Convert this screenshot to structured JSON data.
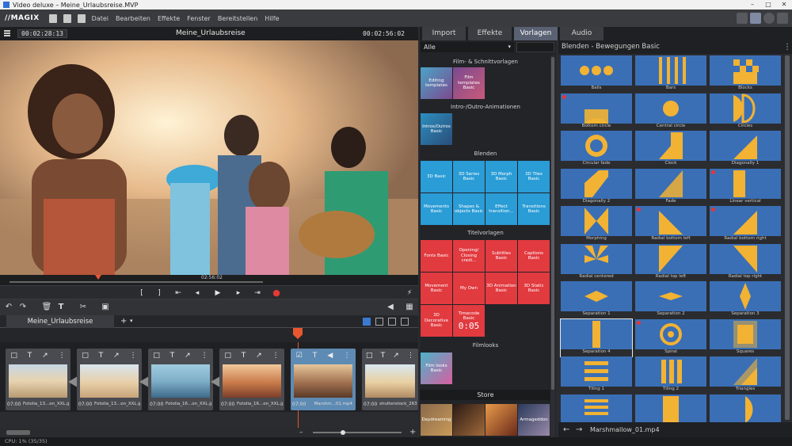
{
  "window": {
    "title": "Video deluxe – Meine_Urlaubsreise.MVP"
  },
  "menubar": {
    "logo": "//MAGIX",
    "items": [
      "Datei",
      "Bearbeiten",
      "Effekte",
      "Fenster",
      "Bereitstellen",
      "Hilfe"
    ]
  },
  "preview": {
    "timecode_left": "00:02:28:13",
    "title": "Meine_Urlaubsreise",
    "timecode_right": "00:02:56:02",
    "scrub_label": "02:56:02",
    "playhead_fraction": 0.24
  },
  "timeline": {
    "tab_label": "Meine_Urlaubsreise",
    "clips": [
      {
        "duration": "07:00",
        "name": "Fotolia_13...on_XXL.jpg",
        "selected": false
      },
      {
        "duration": "07:00",
        "name": "Fotolia_13...on_XXL.jpg",
        "selected": false
      },
      {
        "duration": "07:00",
        "name": "Fotolia_16...on_XXL.jpg",
        "selected": false
      },
      {
        "duration": "07:00",
        "name": "Fotolia_16...on_XXL.jpg",
        "selected": false
      },
      {
        "duration": "07:00",
        "name": "Marshm...01.mp4",
        "selected": true
      },
      {
        "duration": "07:00",
        "name": "shutterstock_26363...",
        "selected": false
      }
    ]
  },
  "status": {
    "cpu": "CPU: 1% (35/35)"
  },
  "right_tabs": [
    "Import",
    "Effekte",
    "Vorlagen",
    "Audio"
  ],
  "right_active_tab": "Vorlagen",
  "templates": {
    "filter": "Alle",
    "sections": {
      "film": {
        "title": "Film- & Schnittvorlagen",
        "items": [
          "Editing templates",
          "Film templates Basic"
        ]
      },
      "intro": {
        "title": "Intro-/Outro-Animationen",
        "items": [
          "Intros/Outros Basic"
        ]
      },
      "blenden": {
        "title": "Blenden",
        "items": [
          "3D Basic",
          "3D Series Basic",
          "3D Morph Basic",
          "3D Tiles Basic",
          "Movements Basic",
          "Shapes & objects Basic",
          "Effect transition...",
          "Transitions Basic"
        ]
      },
      "titel": {
        "title": "Titelvorlagen",
        "items": [
          "Fonts Basic",
          "Opening/ Closing credi...",
          "Subtitles Basic",
          "Captions Basic",
          "Movement Basic",
          "My Own",
          "3D Animation Basic",
          "3D Static Basic",
          "3D Decorative Basic",
          "Timecode Basic"
        ]
      },
      "filmlooks": {
        "title": "Filmlooks",
        "items": [
          "Film looks Basic"
        ]
      },
      "store": {
        "title": "Store",
        "items": [
          "Daydreaming",
          "",
          "",
          "Armageddon"
        ]
      }
    },
    "timecode_tile_text": "0:05"
  },
  "transitions": {
    "header": "Blenden - Bewegungen Basic",
    "footer": "Marshmallow_01.mp4",
    "items": [
      {
        "label": "Balls",
        "dot": false,
        "sel": false
      },
      {
        "label": "Bars",
        "dot": false,
        "sel": false
      },
      {
        "label": "Blocks",
        "dot": false,
        "sel": false
      },
      {
        "label": "Bottom circle",
        "dot": true,
        "sel": false
      },
      {
        "label": "Central circle",
        "dot": false,
        "sel": false
      },
      {
        "label": "Circles",
        "dot": false,
        "sel": false
      },
      {
        "label": "Circular fade",
        "dot": false,
        "sel": false
      },
      {
        "label": "Clock",
        "dot": false,
        "sel": false
      },
      {
        "label": "Diagonally 1",
        "dot": false,
        "sel": false
      },
      {
        "label": "Diagonally 2",
        "dot": false,
        "sel": false
      },
      {
        "label": "Fade",
        "dot": false,
        "sel": false
      },
      {
        "label": "Linear vertical",
        "dot": true,
        "sel": false
      },
      {
        "label": "Morphing",
        "dot": false,
        "sel": false
      },
      {
        "label": "Radial bottom left",
        "dot": true,
        "sel": false
      },
      {
        "label": "Radial bottom right",
        "dot": true,
        "sel": false
      },
      {
        "label": "Radial centered",
        "dot": false,
        "sel": false
      },
      {
        "label": "Radial top left",
        "dot": false,
        "sel": false
      },
      {
        "label": "Radial top right",
        "dot": false,
        "sel": false
      },
      {
        "label": "Separation 1",
        "dot": false,
        "sel": false
      },
      {
        "label": "Separation 2",
        "dot": false,
        "sel": false
      },
      {
        "label": "Separation 3",
        "dot": false,
        "sel": false
      },
      {
        "label": "Separation 4",
        "dot": false,
        "sel": true
      },
      {
        "label": "Spiral",
        "dot": true,
        "sel": false
      },
      {
        "label": "Squares",
        "dot": false,
        "sel": false
      },
      {
        "label": "Tiling 1",
        "dot": false,
        "sel": false
      },
      {
        "label": "Tiling 2",
        "dot": false,
        "sel": false
      },
      {
        "label": "Triangles",
        "dot": false,
        "sel": false
      },
      {
        "label": "",
        "dot": false,
        "sel": false
      },
      {
        "label": "",
        "dot": false,
        "sel": false
      },
      {
        "label": "",
        "dot": false,
        "sel": false
      }
    ]
  },
  "colors": {
    "accent_blue": "#3a6fb5",
    "accent_yellow": "#f2b233",
    "template_blue": "#2a9cd6",
    "template_red": "#e13a3f",
    "record_red": "#e53935",
    "playhead_orange": "#e8572f"
  }
}
